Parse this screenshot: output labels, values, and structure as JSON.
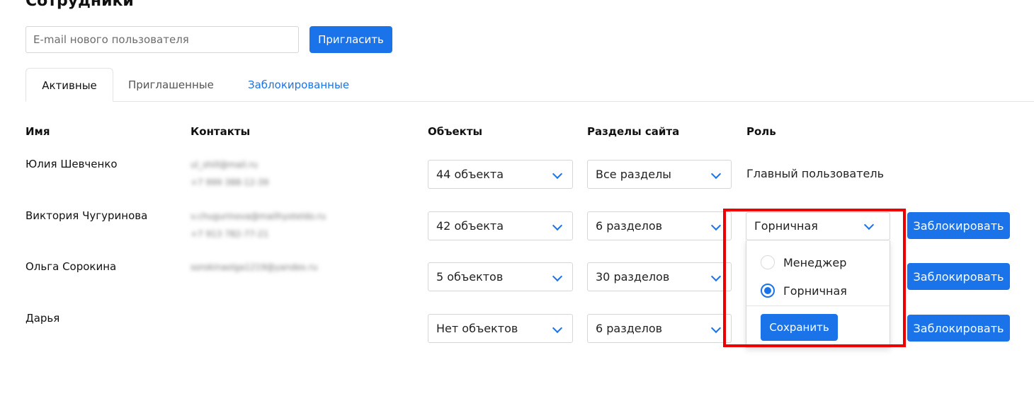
{
  "page": {
    "title": "Сотрудники"
  },
  "invite": {
    "placeholder": "E-mail нового пользователя",
    "button_label": "Пригласить"
  },
  "tabs": [
    {
      "label": "Активные",
      "active": true
    },
    {
      "label": "Приглашенные",
      "active": false
    },
    {
      "label": "Заблокированные",
      "active": false
    }
  ],
  "columns": {
    "name": "Имя",
    "contacts": "Контакты",
    "objects": "Объекты",
    "sections": "Разделы сайта",
    "role": "Роль"
  },
  "rows": [
    {
      "name": "Юлия Шевченко",
      "email": "ul_shill@mail.ru",
      "phone": "+7 999 388-12-39",
      "objects": "44 объекта",
      "sections": "Все разделы",
      "role": "Главный пользователь"
    },
    {
      "name": "Виктория Чугуринова",
      "email": "v.chugurinova@mailhyoteldo.ru",
      "phone": "+7 913 782-77-21",
      "objects": "42 объекта",
      "sections": "6 разделов",
      "role": "Горничная",
      "block_label": "Заблокировать"
    },
    {
      "name": "Ольга Сорокина",
      "email": "sorokinaolga1219@yandex.ru",
      "phone": "",
      "objects": "5 объектов",
      "sections": "30 разделов",
      "block_label": "Заблокировать"
    },
    {
      "name": "Дарья",
      "email": "",
      "phone": "",
      "objects": "Нет объектов",
      "sections": "6 разделов",
      "block_label": "Заблокировать"
    }
  ],
  "role_dropdown": {
    "options": [
      {
        "label": "Менеджер",
        "selected": false
      },
      {
        "label": "Горничная",
        "selected": true
      }
    ],
    "save_label": "Сохранить"
  },
  "colors": {
    "accent": "#1a73e8",
    "highlight": "#ee0000"
  }
}
